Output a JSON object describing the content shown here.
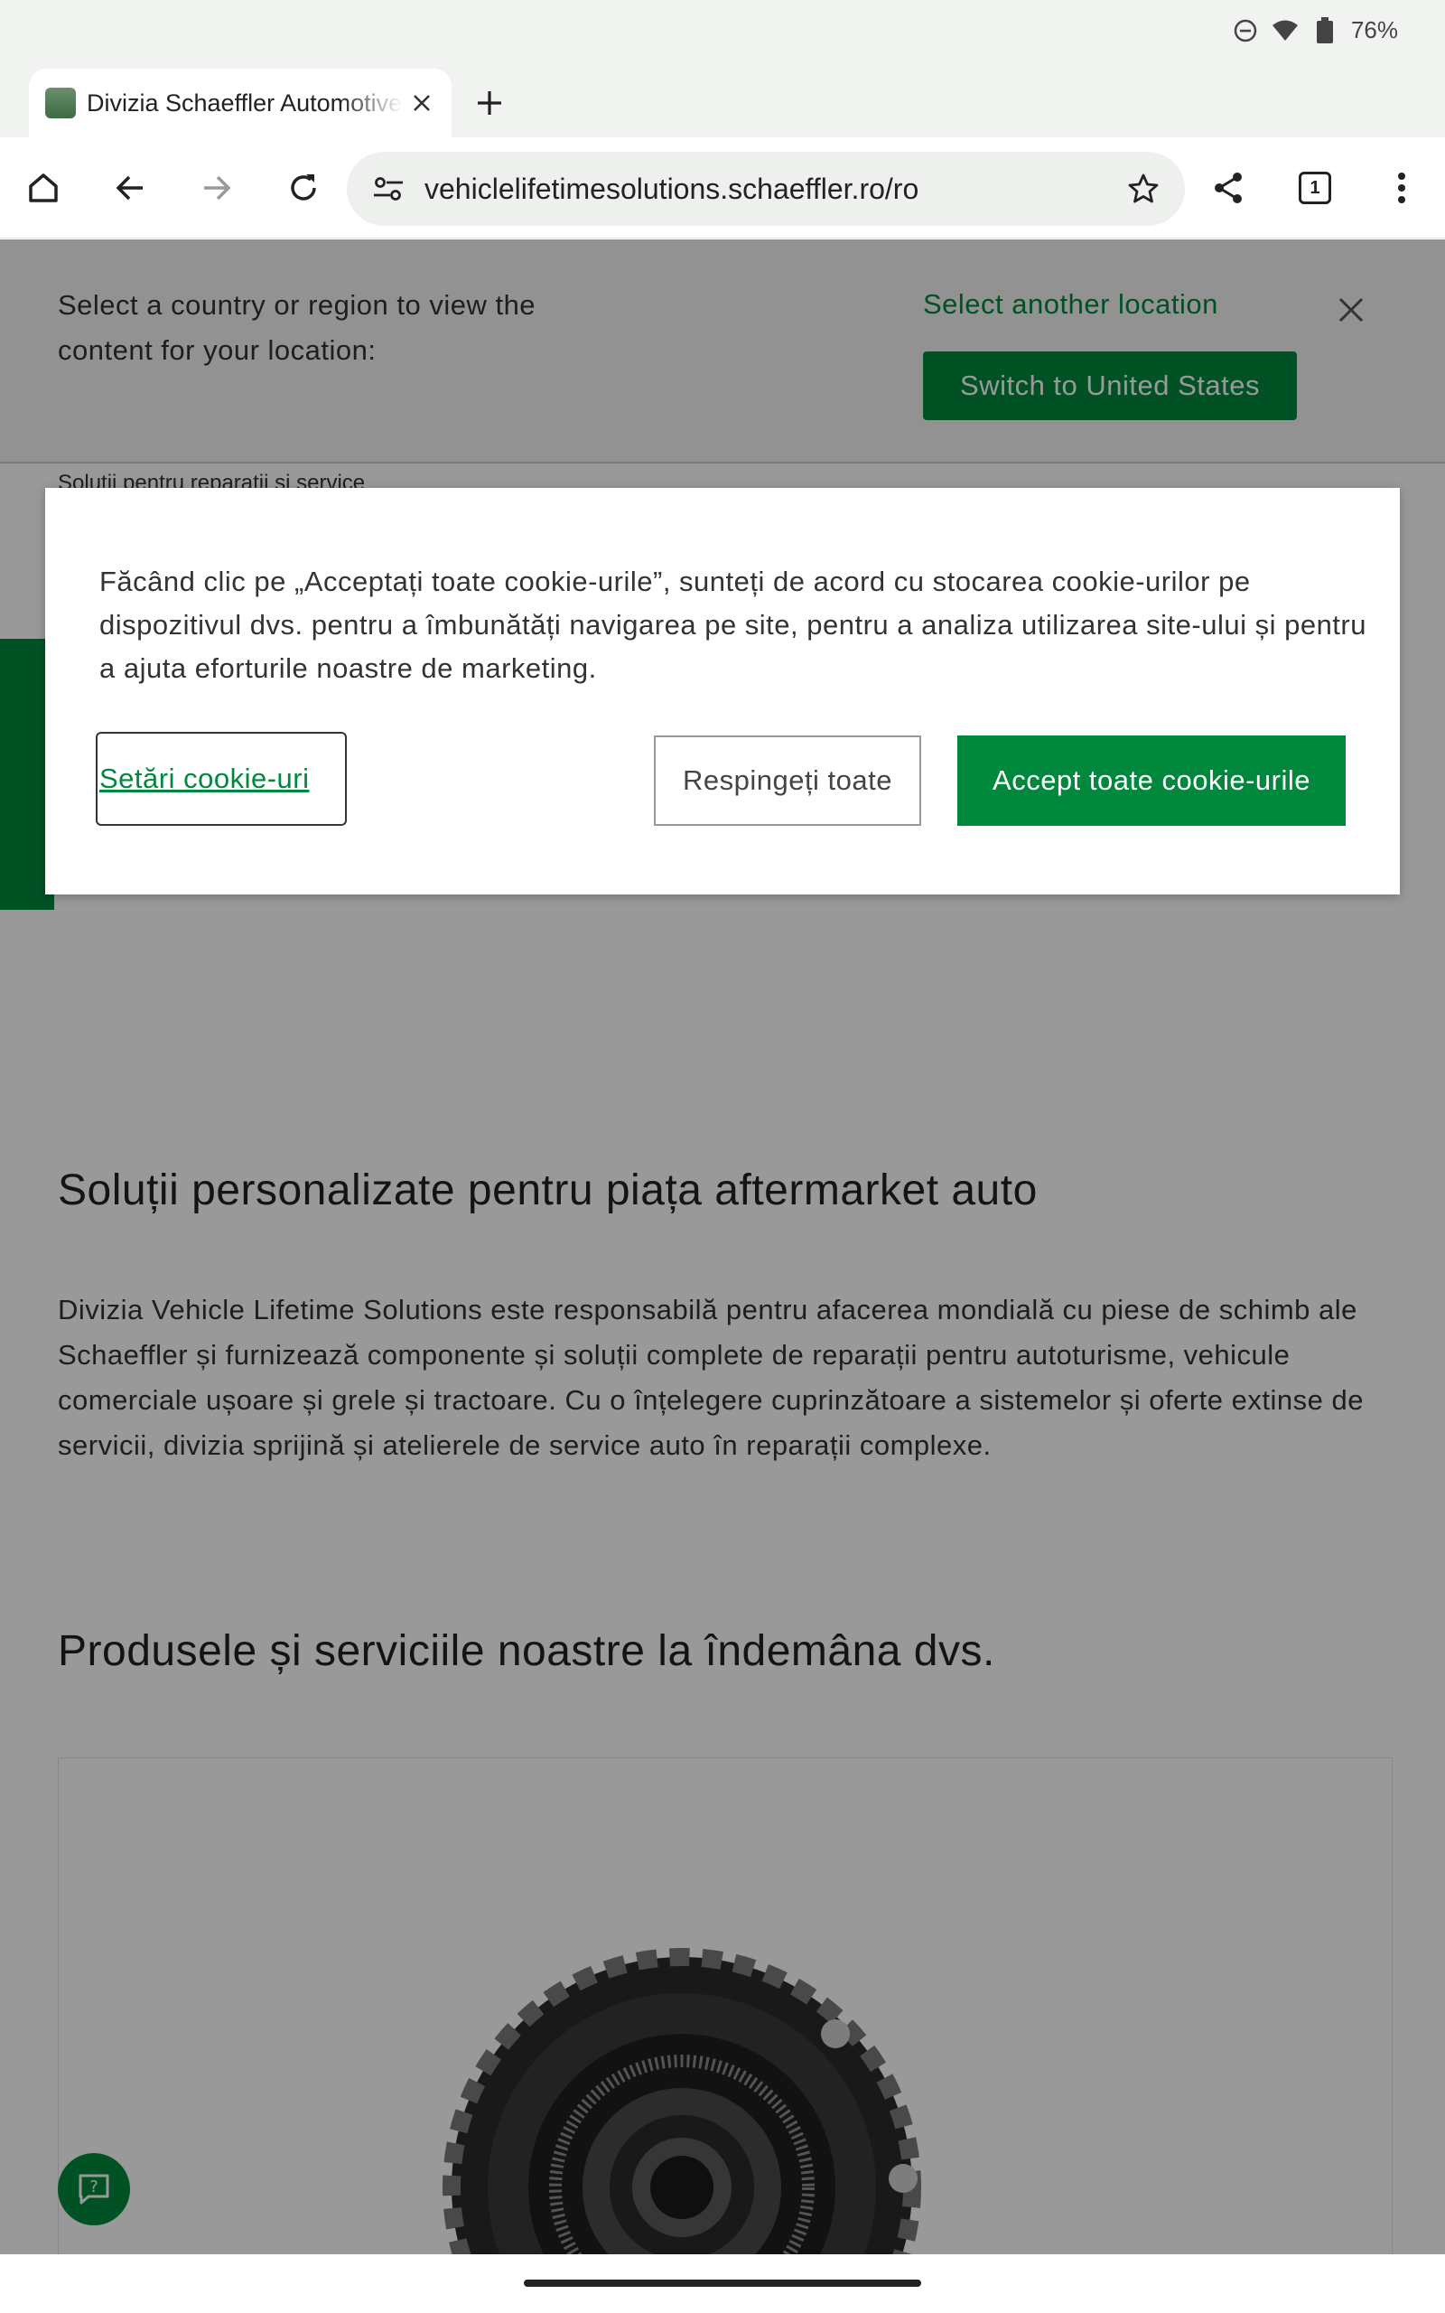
{
  "status_bar": {
    "battery": "76%"
  },
  "browser": {
    "tab_title": "Divizia Schaeffler Automotive",
    "url": "vehiclelifetimesolutions.schaeffler.ro/ro",
    "tab_count": "1"
  },
  "location_banner": {
    "text": "Select a country or region to view the content for your location:",
    "link": "Select another location",
    "switch_button": "Switch to United States"
  },
  "breadcrumb": "Soluții pentru reparații și service",
  "sections": {
    "intro_title": "Soluții personalizate pentru piața aftermarket auto",
    "intro_text": "Divizia Vehicle Lifetime Solutions este responsabilă pentru afacerea mondială cu piese de schimb ale Schaeffler și furnizează componente și soluții complete de reparații pentru autoturisme, vehicule comerciale ușoare și grele și tractoare. Cu o înțelegere cuprinzătoare a sistemelor și oferte extinse de servicii, divizia sprijină și atelierele de service auto în reparații complexe.",
    "products_title": "Produsele și serviciile noastre la îndemâna dvs."
  },
  "cookie_dialog": {
    "text": "Făcând clic pe „Acceptați toate cookie-urile”, sunteți de acord cu stocarea cookie-urilor pe dispozitivul dvs. pentru a îmbunătăți navigarea pe site, pentru a analiza utilizarea site-ului și pentru a ajuta eforturile noastre de marketing.",
    "settings_button": "Setări cookie-uri",
    "reject_button": "Respingeți toate",
    "accept_button": "Accept toate cookie-urile"
  },
  "colors": {
    "brand_green": "#00893d"
  },
  "icons": [
    "dnd-icon",
    "wifi-icon",
    "battery-icon",
    "home-icon",
    "back-icon",
    "forward-icon",
    "reload-icon",
    "site-settings-icon",
    "bookmark-star-icon",
    "share-icon",
    "tab-switcher-icon",
    "more-menu-icon",
    "close-icon",
    "new-tab-icon",
    "chat-feedback-icon"
  ]
}
